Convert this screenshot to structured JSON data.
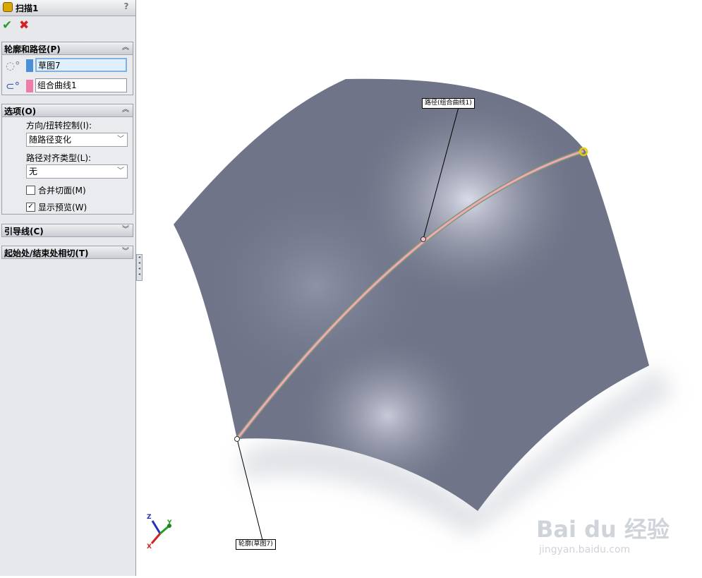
{
  "feature": {
    "title": "扫描1",
    "help": "?",
    "ok": "✔",
    "cancel": "✖"
  },
  "groups": {
    "profile_path": {
      "title": "轮廓和路径(P)",
      "profile_value": "草图7",
      "path_value": "组合曲线1",
      "profile_color": "#4a90d9",
      "path_color": "#f07aa8"
    },
    "options": {
      "title": "选项(O)",
      "orientation_label": "方向/扭转控制(I):",
      "orientation_value": "随路径变化",
      "align_label": "路径对齐类型(L):",
      "align_value": "无",
      "merge_label": "合并切面(M)",
      "merge_checked": false,
      "preview_label": "显示预览(W)",
      "preview_checked": true
    },
    "guides": {
      "title": "引导线(C)"
    },
    "tangency": {
      "title": "起始处/结束处相切(T)"
    }
  },
  "viewport": {
    "path_callout": "路径(组合曲线1)",
    "profile_callout": "轮廓(草图7)",
    "surface_color": "#6f7488",
    "highlight_color": "#f3a6bd",
    "endpoint_color": "#ffea00"
  },
  "triad": {
    "x": "X",
    "y": "Y",
    "z": "Z"
  },
  "watermark": {
    "logo": "Bai du 经验",
    "url": "jingyan.baidu.com"
  }
}
